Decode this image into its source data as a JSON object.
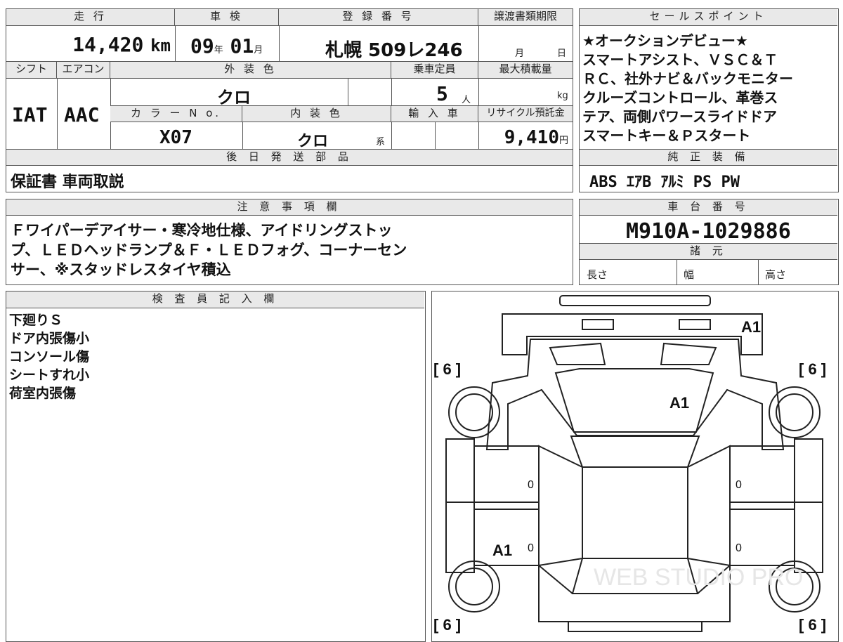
{
  "vehicle": {
    "mileage_header": "走 行",
    "mileage": "14,420",
    "mileage_unit": "km",
    "inspection_header": "車 検",
    "inspection_year": "09",
    "year_unit": "年",
    "inspection_month": "01",
    "month_unit": "月",
    "registration_header": "登 録 番 号",
    "registration": "札幌 509レ246",
    "transfer_header": "譲渡書類期限",
    "transfer_month_unit": "月",
    "transfer_day_unit": "日",
    "shift_header": "シフト",
    "shift": "IAT",
    "aircon_header": "エアコン",
    "aircon": "AAC",
    "exterior_header": "外 装 色",
    "exterior_color": "クロ",
    "capacity_header": "乗車定員",
    "capacity": "5",
    "capacity_unit": "人",
    "maxload_header": "最大積載量",
    "maxload_unit": "kg",
    "colorno_header": "カ ラ ー N o.",
    "color_no": "X07",
    "interior_header": "内 装 色",
    "interior_color": "クロ",
    "interior_suffix": "系",
    "import_header": "輸 入 車",
    "recycle_header": "リサイクル預託金",
    "recycle_fee": "9,410",
    "recycle_unit": "円",
    "later_parts_header": "後 日 発 送 部 品",
    "later_parts": "保証書 車両取説"
  },
  "sales_points": {
    "header": "セールスポイント",
    "lines": [
      "★オークションデビュー★",
      "スマートアシスト、ＶＳＣ＆Ｔ",
      "ＲＣ、社外ナビ＆バックモニター",
      "クルーズコントロール、革巻ス",
      "テア、両側パワースライドドア",
      "スマートキー＆Ｐスタート"
    ],
    "equipment_header": "純 正 装 備",
    "equipment": "ABS ｴｱB ｱﾙﾐ PS PW"
  },
  "notes": {
    "header": "注 意 事 項 欄",
    "lines": [
      "Ｆワイパーデアイサー・寒冷地仕様、アイドリングストッ",
      "プ、ＬＥＤヘッドランプ＆Ｆ・ＬＥＤフォグ、コーナーセン",
      "サー、※スタッドレスタイヤ積込"
    ]
  },
  "chassis": {
    "header": "車 台 番 号",
    "number": "M910A-1029886",
    "specs_header": "諸 元",
    "length_label": "長さ",
    "width_label": "幅",
    "height_label": "高さ"
  },
  "inspector": {
    "header": "検 査 員 記 入 欄",
    "lines": [
      "下廻りＳ",
      "ドア内張傷小",
      "コンソール傷",
      "シートすれ小",
      "荷室内張傷"
    ]
  },
  "diagram": {
    "tire_fl": "[ 6 ]",
    "tire_fr": "[ 6 ]",
    "tire_rl": "[ 6 ]",
    "tire_rr": "[ 6 ]",
    "mark_front": "A1",
    "mark_hood": "A1",
    "mark_left_rear": "A1",
    "zero": "0",
    "watermark": "WEB STUDIO PRO"
  }
}
